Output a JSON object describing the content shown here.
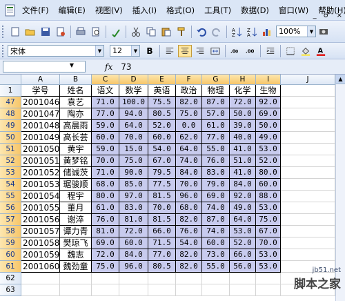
{
  "menu": {
    "items": [
      "文件(F)",
      "编辑(E)",
      "视图(V)",
      "插入(I)",
      "格式(O)",
      "工具(T)",
      "数据(D)",
      "窗口(W)",
      "帮助(H)"
    ],
    "window_controls": [
      "_",
      "♂",
      "×"
    ]
  },
  "toolbar": {
    "zoom": "100%",
    "font_name": "宋体",
    "font_size": "12",
    "bold": "B"
  },
  "formula_bar": {
    "name_box": "",
    "fx": "fx",
    "value": "73"
  },
  "columns": [
    {
      "letter": "A",
      "width": 56
    },
    {
      "letter": "B",
      "width": 46
    },
    {
      "letter": "C",
      "width": 40
    },
    {
      "letter": "D",
      "width": 42
    },
    {
      "letter": "E",
      "width": 40
    },
    {
      "letter": "F",
      "width": 38
    },
    {
      "letter": "G",
      "width": 40
    },
    {
      "letter": "H",
      "width": 38
    },
    {
      "letter": "I",
      "width": 36
    },
    {
      "letter": "J",
      "width": 79
    }
  ],
  "header_row": {
    "num": "1",
    "cells": [
      "学号",
      "姓名",
      "语文",
      "数学",
      "英语",
      "政治",
      "物理",
      "化学",
      "生物"
    ]
  },
  "rows": [
    {
      "num": "47",
      "cells": [
        "2001046",
        "袁艺",
        "71.0",
        "100.0",
        "75.5",
        "82.0",
        "87.0",
        "72.0",
        "92.0"
      ]
    },
    {
      "num": "48",
      "cells": [
        "2001047",
        "陶亦",
        "77.0",
        "94.0",
        "80.5",
        "75.0",
        "57.0",
        "50.0",
        "69.0"
      ]
    },
    {
      "num": "49",
      "cells": [
        "2001048",
        "高晨雨",
        "59.0",
        "64.0",
        "52.0",
        "0.0",
        "61.0",
        "39.0",
        "50.0"
      ]
    },
    {
      "num": "50",
      "cells": [
        "2001049",
        "高长芸",
        "60.0",
        "70.0",
        "60.0",
        "62.0",
        "77.0",
        "40.0",
        "49.0"
      ]
    },
    {
      "num": "51",
      "cells": [
        "2001050",
        "黄宇",
        "59.0",
        "15.0",
        "54.0",
        "64.0",
        "55.0",
        "41.0",
        "53.0"
      ]
    },
    {
      "num": "52",
      "cells": [
        "2001051",
        "黄梦铭",
        "70.0",
        "75.0",
        "67.0",
        "74.0",
        "76.0",
        "51.0",
        "52.0"
      ]
    },
    {
      "num": "53",
      "cells": [
        "2001052",
        "储诚茨",
        "71.0",
        "90.0",
        "79.5",
        "84.0",
        "83.0",
        "41.0",
        "80.0"
      ]
    },
    {
      "num": "54",
      "cells": [
        "2001053",
        "琚骏顺",
        "68.0",
        "85.0",
        "77.5",
        "70.0",
        "79.0",
        "84.0",
        "60.0"
      ]
    },
    {
      "num": "55",
      "cells": [
        "2001054",
        "程宇",
        "80.0",
        "97.0",
        "81.5",
        "96.0",
        "69.0",
        "92.0",
        "88.0"
      ]
    },
    {
      "num": "56",
      "cells": [
        "2001055",
        "董月",
        "61.0",
        "83.0",
        "70.0",
        "68.0",
        "74.0",
        "49.0",
        "53.0"
      ]
    },
    {
      "num": "57",
      "cells": [
        "2001056",
        "谢淬",
        "76.0",
        "81.0",
        "81.5",
        "82.0",
        "87.0",
        "64.0",
        "75.0"
      ]
    },
    {
      "num": "58",
      "cells": [
        "2001057",
        "谭力青",
        "81.0",
        "72.0",
        "66.0",
        "76.0",
        "74.0",
        "53.0",
        "67.0"
      ]
    },
    {
      "num": "59",
      "cells": [
        "2001058",
        "樊琼飞",
        "69.0",
        "60.0",
        "71.5",
        "54.0",
        "60.0",
        "52.0",
        "70.0"
      ]
    },
    {
      "num": "60",
      "cells": [
        "2001059",
        "魏志",
        "72.0",
        "84.0",
        "77.0",
        "82.0",
        "73.0",
        "66.0",
        "53.0"
      ]
    },
    {
      "num": "61",
      "cells": [
        "2001060",
        "魏劲童",
        "75.0",
        "96.0",
        "80.5",
        "82.0",
        "55.0",
        "56.0",
        "53.0"
      ]
    },
    {
      "num": "62",
      "cells": [
        "",
        "",
        "",
        "",
        "",
        "",
        "",
        "",
        ""
      ]
    },
    {
      "num": "63",
      "cells": [
        "",
        "",
        "",
        "",
        "",
        "",
        "",
        "",
        ""
      ]
    }
  ],
  "watermark": {
    "site": "jb51.net",
    "name": "脚本之家"
  },
  "colors": {
    "selection": "#c8cbee",
    "header_selected": "#f7c66a",
    "toolbar_bg": "#dbe6f6"
  }
}
